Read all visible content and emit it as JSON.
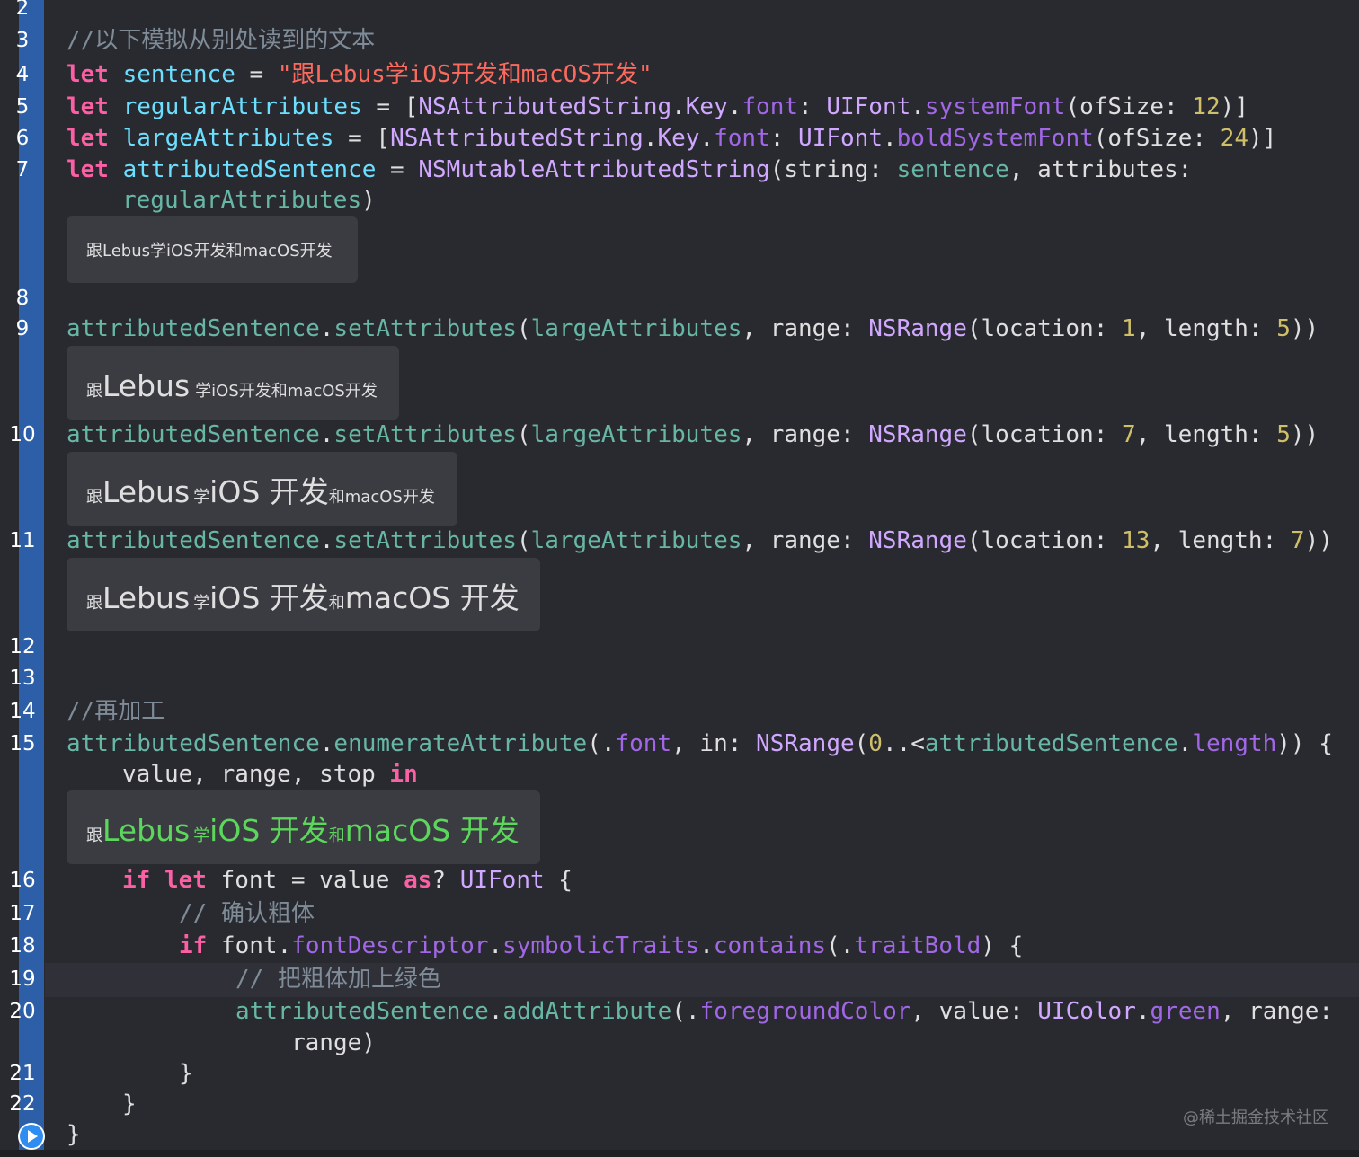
{
  "line_numbers": [
    "2",
    "3",
    "4",
    "5",
    "6",
    "7",
    "8",
    "9",
    "10",
    "11",
    "12",
    "13",
    "14",
    "15",
    "16",
    "17",
    "18",
    "19",
    "20",
    "21",
    "22"
  ],
  "code": {
    "l3": "//以下模拟从别处读到的文本",
    "l4": {
      "kw": "let",
      "var": "sentence",
      "eq": " = ",
      "str": "\"跟Lebus学iOS开发和macOS开发\""
    },
    "l5": {
      "kw": "let",
      "var": "regularAttributes",
      "rest1": " = [",
      "t1": "NSAttributedString",
      "d1": ".",
      "t2": "Key",
      "d2": ".",
      "p1": "font",
      "c1": ": ",
      "t3": "UIFont",
      "d3": ".",
      "f1": "systemFont",
      "a1": "(ofSize: ",
      "n1": "12",
      "e1": ")]"
    },
    "l6": {
      "kw": "let",
      "var": "largeAttributes",
      "rest1": " = [",
      "t1": "NSAttributedString",
      "d1": ".",
      "t2": "Key",
      "d2": ".",
      "p1": "font",
      "c1": ": ",
      "t3": "UIFont",
      "d3": ".",
      "f1": "boldSystemFont",
      "a1": "(ofSize: ",
      "n1": "24",
      "e1": ")]"
    },
    "l7a": {
      "kw": "let",
      "var": "attributedSentence",
      "eq": " = ",
      "t1": "NSMutableAttributedString",
      "a1": "(string: ",
      "v1": "sentence",
      "a2": ", attributes:"
    },
    "l7b": {
      "v1": "regularAttributes",
      "e1": ")"
    },
    "l9": {
      "v1": "attributedSentence",
      "d1": ".",
      "f1": "setAttributes",
      "p1": "(",
      "v2": "largeAttributes",
      "a1": ", range: ",
      "t1": "NSRange",
      "a2": "(location: ",
      "n1": "1",
      "a3": ", length: ",
      "n2": "5",
      "e1": "))"
    },
    "l10": {
      "v1": "attributedSentence",
      "d1": ".",
      "f1": "setAttributes",
      "p1": "(",
      "v2": "largeAttributes",
      "a1": ", range: ",
      "t1": "NSRange",
      "a2": "(location: ",
      "n1": "7",
      "a3": ", length: ",
      "n2": "5",
      "e1": "))"
    },
    "l11": {
      "v1": "attributedSentence",
      "d1": ".",
      "f1": "setAttributes",
      "p1": "(",
      "v2": "largeAttributes",
      "a1": ", range: ",
      "t1": "NSRange",
      "a2": "(location: ",
      "n1": "13",
      "a3": ", length: ",
      "n2": "7",
      "e1": "))"
    },
    "l14": "//再加工",
    "l15a": {
      "v1": "attributedSentence",
      "d1": ".",
      "f1": "enumerateAttribute",
      "p1": "(.",
      "p2": "font",
      "a1": ", in: ",
      "t1": "NSRange",
      "a2": "(",
      "n1": "0",
      "a3": "..<",
      "v2": "attributedSentence",
      "d2": ".",
      "p3": "length",
      "e1": ")) {"
    },
    "l15b": {
      "a1": "value, range, stop ",
      "kw": "in"
    },
    "l16": {
      "k1": "if",
      "k2": "let",
      "a1": " font = value ",
      "k3": "as",
      "a2": "? ",
      "t1": "UIFont",
      "e1": " {"
    },
    "l17": "// 确认粗体",
    "l18": {
      "k1": "if",
      "a1": " font.",
      "p1": "fontDescriptor",
      "d1": ".",
      "p2": "symbolicTraits",
      "d2": ".",
      "f1": "contains",
      "a2": "(.",
      "p3": "traitBold",
      "e1": ") {"
    },
    "l19": "// 把粗体加上绿色",
    "l20a": {
      "v1": "attributedSentence",
      "d1": ".",
      "f1": "addAttribute",
      "a1": "(.",
      "p1": "foregroundColor",
      "a2": ", value: ",
      "t1": "UIColor",
      "d2": ".",
      "p2": "green",
      "e1": ", range:"
    },
    "l20b": "range)",
    "l21": "}",
    "l22": "}",
    "l23": "}"
  },
  "results": {
    "r1": {
      "text": "跟Lebus学iOS开发和macOS开发"
    },
    "r2": {
      "s1": "跟",
      "b1": "Lebus",
      "s2": "学iOS开发和macOS开发"
    },
    "r3": {
      "s1": "跟",
      "b1": "Lebus",
      "s2": "学",
      "b2": "iOS 开发",
      "s3": "和macOS开发"
    },
    "r4": {
      "s1": "跟",
      "b1": "Lebus",
      "s2": "学",
      "b2": "iOS 开发",
      "s3": "和",
      "b3": "macOS 开发"
    },
    "r5": {
      "s1": "跟",
      "b1": "Lebus",
      "s2": "学",
      "b2": "iOS 开发",
      "s3": "和",
      "b3": "macOS 开发"
    }
  },
  "watermark": "@稀土掘金技术社区",
  "colors": {
    "background": "#292a30",
    "keyword": "#fc5fa3",
    "string": "#fc6a5d",
    "comment": "#7f8c98",
    "number": "#d0bf69",
    "green": "#5cd65c"
  }
}
